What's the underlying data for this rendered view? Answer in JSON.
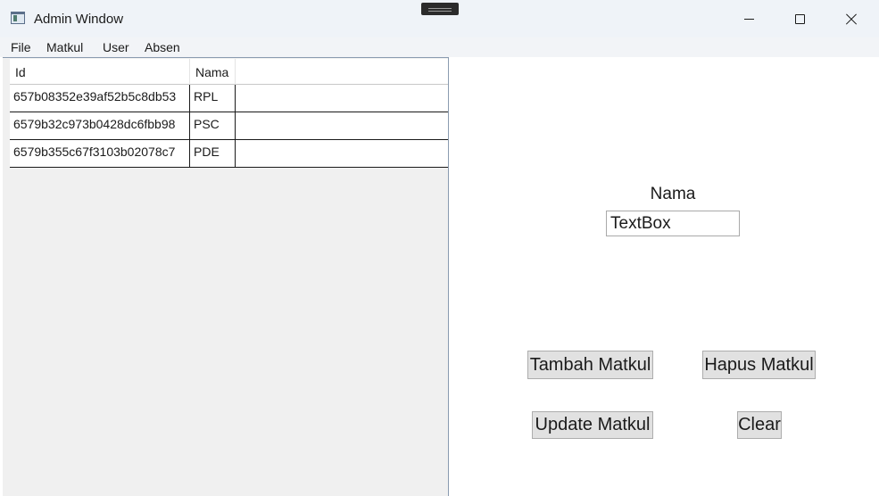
{
  "window": {
    "title": "Admin Window",
    "icon": "app-window-icon"
  },
  "menu": {
    "items": [
      "File",
      "Matkul",
      "User",
      "Absen"
    ]
  },
  "grid": {
    "columns": [
      "Id",
      "Nama"
    ],
    "rows": [
      [
        "657b08352e39af52b5c8db53",
        "RPL"
      ],
      [
        "6579b32c973b0428dc6fbb98",
        "PSC"
      ],
      [
        "6579b355c67f3103b02078c7",
        "PDE"
      ]
    ]
  },
  "form": {
    "label": "Nama",
    "textbox_value": "TextBox"
  },
  "buttons": {
    "tambah": "Tambah Matkul",
    "hapus": "Hapus Matkul",
    "update": "Update Matkul",
    "clear": "Clear"
  }
}
